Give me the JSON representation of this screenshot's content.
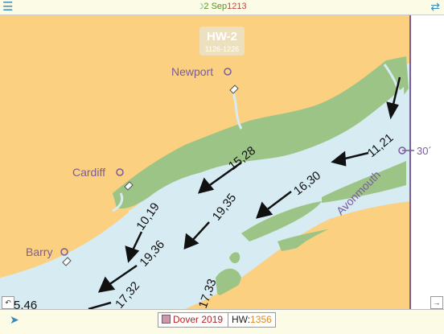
{
  "topbar": {
    "date": "2 Sep",
    "time": "1213"
  },
  "hw_label": {
    "title": "HW-2",
    "range": "1126-1226"
  },
  "places": {
    "newport": "Newport",
    "cardiff": "Cardiff",
    "barry": "Barry",
    "avonmouth": "Avonmouth",
    "lat_mark": "30´"
  },
  "streams": [
    {
      "label": "11,21",
      "angle": -40
    },
    {
      "label": "15,28",
      "angle": -38
    },
    {
      "label": "16,30",
      "angle": -38
    },
    {
      "label": "10,19",
      "angle": -55
    },
    {
      "label": "19,35",
      "angle": -52
    },
    {
      "label": "19,36",
      "angle": -48
    },
    {
      "label": "17,32",
      "angle": -50
    },
    {
      "label": "17,33",
      "angle": -70
    },
    {
      "label": "5,46",
      "angle": 0
    }
  ],
  "bottombar": {
    "port": "Dover 2019",
    "hw_label": "HW:",
    "hw_time": "1356"
  },
  "icons": {
    "menu": "hamburger-icon",
    "sync": "swap-arrows-icon",
    "nav": "location-arrow-icon"
  }
}
